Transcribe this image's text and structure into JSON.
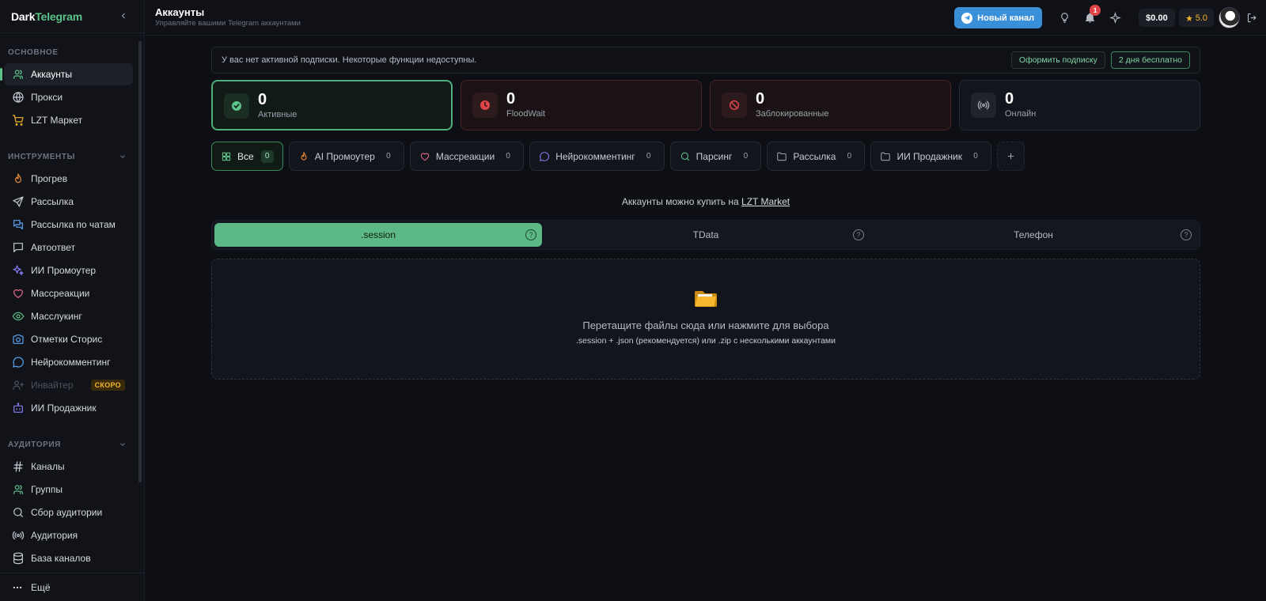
{
  "brand": {
    "part1": "Dark",
    "part2": "Telegram"
  },
  "sidebar": {
    "sections": [
      {
        "title": "ОСНОВНОЕ",
        "items": [
          {
            "label": "Аккаунты",
            "icon": "users-icon",
            "active": true
          },
          {
            "label": "Прокси",
            "icon": "globe-icon"
          },
          {
            "label": "LZT Маркет",
            "icon": "cart-icon"
          }
        ]
      },
      {
        "title": "ИНСТРУМЕНТЫ",
        "items": [
          {
            "label": "Прогрев",
            "icon": "flame-icon"
          },
          {
            "label": "Рассылка",
            "icon": "send-icon"
          },
          {
            "label": "Рассылка по чатам",
            "icon": "chats-icon"
          },
          {
            "label": "Автоответ",
            "icon": "message-icon"
          },
          {
            "label": "ИИ Промоутер",
            "icon": "sparkles-icon"
          },
          {
            "label": "Массреакции",
            "icon": "heart-icon"
          },
          {
            "label": "Масслукинг",
            "icon": "eye-icon"
          },
          {
            "label": "Отметки Сторис",
            "icon": "camera-icon"
          },
          {
            "label": "Нейрокомментинг",
            "icon": "comment-icon"
          },
          {
            "label": "Инвайтер",
            "icon": "user-plus-icon",
            "disabled": true,
            "badge": "СКОРО"
          },
          {
            "label": "ИИ Продажник",
            "icon": "bot-icon"
          }
        ]
      },
      {
        "title": "АУДИТОРИЯ",
        "items": [
          {
            "label": "Каналы",
            "icon": "hash-icon"
          },
          {
            "label": "Группы",
            "icon": "users-icon"
          },
          {
            "label": "Сбор аудитории",
            "icon": "search-icon"
          },
          {
            "label": "Аудитория",
            "icon": "radio-icon"
          },
          {
            "label": "База каналов",
            "icon": "database-icon"
          }
        ]
      }
    ],
    "footer": {
      "label": "Ещё",
      "icon": "more-icon"
    }
  },
  "header": {
    "title": "Аккаунты",
    "subtitle": "Управляйте вашими Telegram аккаунтами",
    "new_channel_label": "Новый канал",
    "notification_count": "1",
    "balance": "$0.00",
    "rating": "5.0"
  },
  "banner": {
    "text": "У вас нет активной подписки. Некоторые функции недоступны.",
    "subscribe_label": "Оформить подписку",
    "trial_label": "2 дня бесплатно"
  },
  "stats": [
    {
      "value": "0",
      "label": "Активные",
      "icon": "check-circle-icon",
      "variant": "green",
      "color": "#5cc38a"
    },
    {
      "value": "0",
      "label": "FloodWait",
      "icon": "clock-icon",
      "variant": "red",
      "color": "#e0454a"
    },
    {
      "value": "0",
      "label": "Заблокированные",
      "icon": "ban-icon",
      "variant": "red",
      "color": "#e0454a"
    },
    {
      "value": "0",
      "label": "Онлайн",
      "icon": "radio-icon",
      "variant": "gray",
      "color": "#9aa0ab"
    }
  ],
  "filters": [
    {
      "label": "Все",
      "count": "0",
      "icon": "grid-icon",
      "active": true,
      "color": "#5cc38a"
    },
    {
      "label": "AI Промоутер",
      "count": "0",
      "icon": "flame-icon",
      "color": "#f08c3a"
    },
    {
      "label": "Массреакции",
      "count": "0",
      "icon": "heart-icon",
      "color": "#e86a8a"
    },
    {
      "label": "Нейрокомментинг",
      "count": "0",
      "icon": "comment-icon",
      "color": "#8b7cf6"
    },
    {
      "label": "Парсинг",
      "count": "0",
      "icon": "search-icon",
      "color": "#5cc38a"
    },
    {
      "label": "Рассылка",
      "count": "0",
      "icon": "folder-icon",
      "color": "#9aa0ab"
    },
    {
      "label": "ИИ Продажник",
      "count": "0",
      "icon": "folder-icon",
      "color": "#9aa0ab"
    }
  ],
  "market": {
    "prefix": "Аккаунты можно купить на",
    "link": "LZT Market"
  },
  "tabs": [
    {
      "label": ".session",
      "active": true
    },
    {
      "label": "TData"
    },
    {
      "label": "Телефон"
    }
  ],
  "help_glyph": "?",
  "dropzone": {
    "title": "Перетащите файлы сюда или нажмите для выбора",
    "hint": ".session + .json (рекомендуется) или .zip с несколькими аккаунтами"
  },
  "colors": {
    "accent": "#5cc38a",
    "danger": "#e0454a",
    "brand_blue": "#3a8fd9",
    "gold": "#f0b429"
  }
}
